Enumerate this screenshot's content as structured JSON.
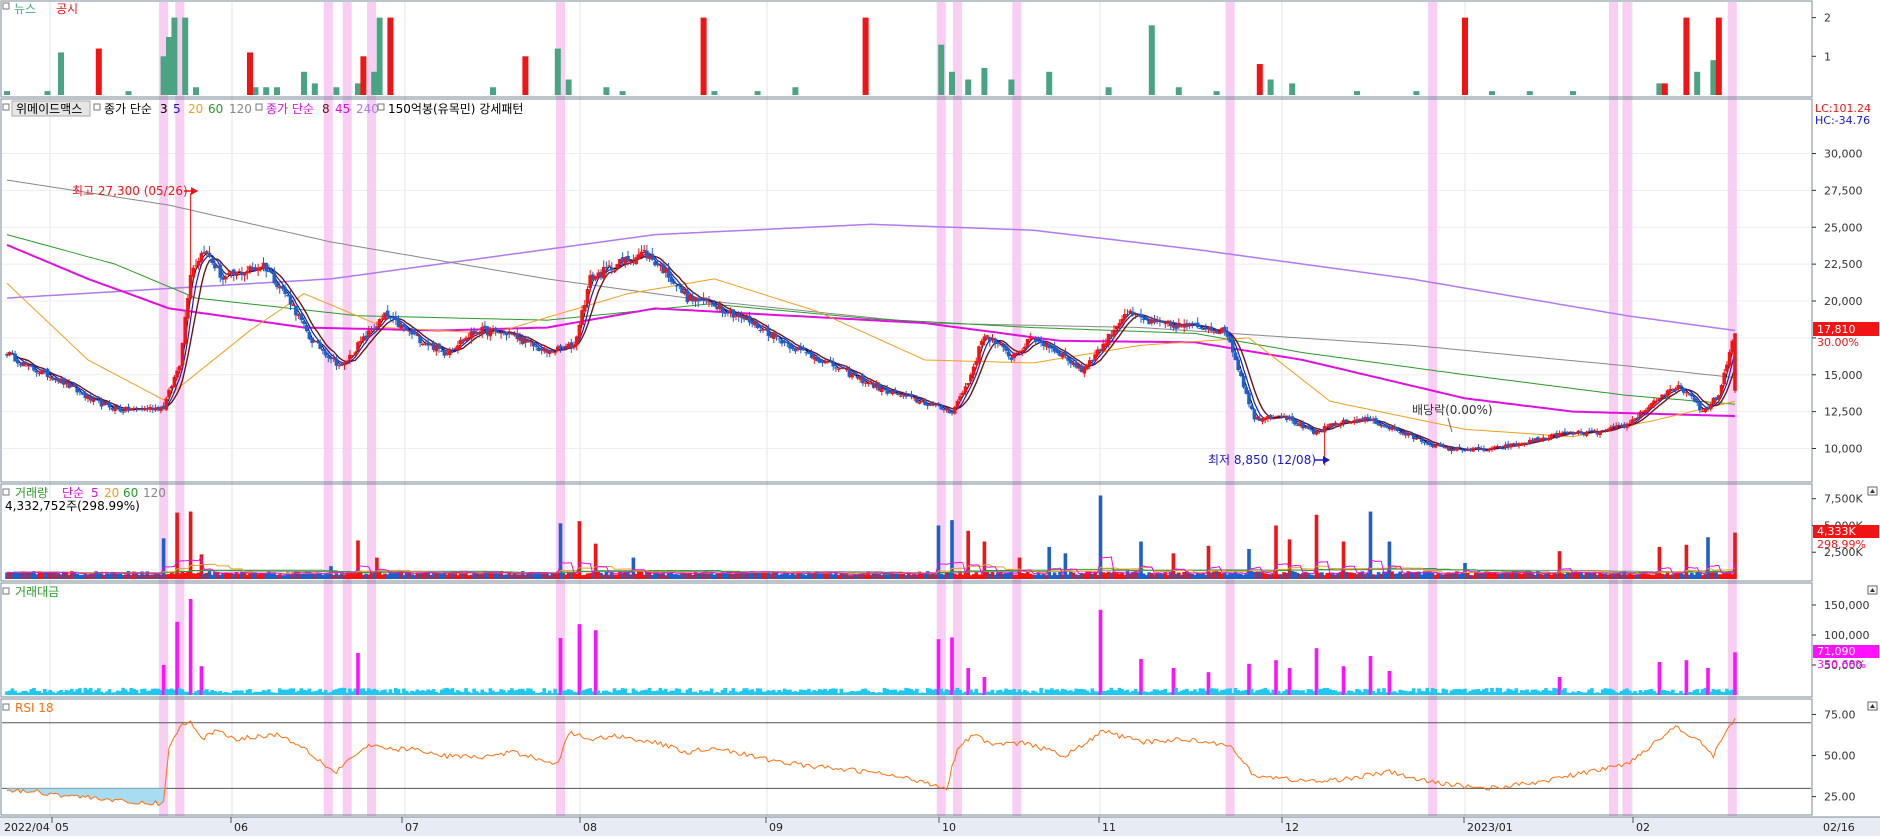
{
  "colors": {
    "up": "#f01414",
    "down": "#1e5fc8",
    "news": "#4aa382",
    "highlight": "#f7c6f1",
    "ma3": "#000000",
    "ma5": "#1818c8",
    "ma20": "#f0a020",
    "ma60": "#2a9a2a",
    "ma120": "#888888",
    "ma8": "#6a1414",
    "ma45": "#e010e0",
    "ma240": "#b07af0",
    "volMa5": "#e010e0",
    "volMa20": "#f0a020",
    "volMa60": "#2a9a2a",
    "volMa120": "#888888",
    "amtHigh": "#ff10ff",
    "amtLow": "#20c8f0",
    "rsi": "#ff7010",
    "rsiFill": "#a8dcf0"
  },
  "panels": {
    "news": {
      "label_news": "뉴스",
      "label_disclosure": "공시",
      "ticks": [
        "2",
        "1"
      ]
    },
    "price": {
      "stock_name": "위메이드맥스",
      "ma_group1": "종가 단순",
      "ma_group1_periods": [
        "3",
        "5",
        "20",
        "60",
        "120"
      ],
      "ma_group2": "종가 단순",
      "ma_group2_periods": [
        "8",
        "45",
        "240"
      ],
      "pattern": "150억봉(유목민) 강세패턴",
      "lc_label": "LC:101.24",
      "hc_label": "HC:-34.76",
      "ticks": [
        "30,000",
        "27,500",
        "25,000",
        "22,500",
        "20,000",
        "17,500",
        "15,000",
        "12,500",
        "10,000"
      ],
      "last_price": "17,810",
      "last_change": "30.00%",
      "high_annotation": "최고 27,300 (05/26)",
      "low_annotation": "최저 8,850 (12/08)",
      "dividend_annotation": "배당락(0.00%)"
    },
    "volume": {
      "title": "거래량",
      "ma_label": "단순",
      "ma_periods": [
        "5",
        "20",
        "60",
        "120"
      ],
      "info": "4,332,752주(298.99%)",
      "ticks": [
        "7,500K",
        "5,000K",
        "2,500K"
      ],
      "last_value": "4,333K",
      "last_pct": "298.99%"
    },
    "amount": {
      "title": "거래대금",
      "ticks": [
        "150,000",
        "100,000",
        "50,000"
      ],
      "last_value": "71,090",
      "last_pct": "350.68%"
    },
    "rsi": {
      "title": "RSI 18",
      "ticks": [
        "75.00",
        "50.00",
        "25.00"
      ]
    }
  },
  "x_axis": {
    "labels": [
      "2022/04",
      "05",
      "06",
      "07",
      "08",
      "09",
      "10",
      "11",
      "12",
      "2023/01",
      "02",
      "02/16"
    ]
  },
  "chart_data": {
    "type": "candlestick",
    "x_start": "2022/04",
    "x_end": "02/16",
    "price": {
      "ylim": [
        8000,
        32000
      ],
      "anchors": [
        [
          0,
          16500
        ],
        [
          8,
          15500
        ],
        [
          18,
          14800
        ],
        [
          32,
          13200
        ],
        [
          42,
          12600
        ],
        [
          58,
          12800
        ],
        [
          64,
          15800
        ],
        [
          68,
          22000
        ],
        [
          73,
          23500
        ],
        [
          80,
          21500
        ],
        [
          95,
          22500
        ],
        [
          105,
          20000
        ],
        [
          112,
          17500
        ],
        [
          124,
          15500
        ],
        [
          130,
          17000
        ],
        [
          140,
          19000
        ],
        [
          152,
          17500
        ],
        [
          162,
          16500
        ],
        [
          174,
          18000
        ],
        [
          186,
          17800
        ],
        [
          200,
          16500
        ],
        [
          210,
          17000
        ],
        [
          216,
          21500
        ],
        [
          226,
          22500
        ],
        [
          236,
          23300
        ],
        [
          244,
          22000
        ],
        [
          252,
          20200
        ],
        [
          262,
          19800
        ],
        [
          276,
          18500
        ],
        [
          292,
          16800
        ],
        [
          306,
          15600
        ],
        [
          324,
          14000
        ],
        [
          338,
          13200
        ],
        [
          350,
          12500
        ],
        [
          356,
          14500
        ],
        [
          362,
          17800
        ],
        [
          372,
          16200
        ],
        [
          380,
          17500
        ],
        [
          390,
          16500
        ],
        [
          398,
          15300
        ],
        [
          406,
          17000
        ],
        [
          414,
          19200
        ],
        [
          424,
          18500
        ],
        [
          436,
          18300
        ],
        [
          446,
          18200
        ],
        [
          452,
          17800
        ],
        [
          462,
          12000
        ],
        [
          472,
          12300
        ],
        [
          484,
          11000
        ],
        [
          492,
          11700
        ],
        [
          504,
          12000
        ],
        [
          520,
          10800
        ],
        [
          532,
          10000
        ],
        [
          548,
          9900
        ],
        [
          560,
          10300
        ],
        [
          576,
          11000
        ],
        [
          590,
          11100
        ],
        [
          600,
          11600
        ],
        [
          612,
          13500
        ],
        [
          620,
          14200
        ],
        [
          628,
          12500
        ],
        [
          634,
          13600
        ],
        [
          640,
          17810
        ]
      ],
      "high": {
        "index": 68,
        "value": 27300,
        "date": "05/26"
      },
      "low": {
        "index": 488,
        "value": 8850,
        "date": "12/08"
      },
      "last": 17810,
      "last_change_pct": 30.0
    },
    "moving_averages": {
      "ma240": [
        [
          0,
          20200
        ],
        [
          120,
          21500
        ],
        [
          240,
          24500
        ],
        [
          320,
          25200
        ],
        [
          380,
          24800
        ],
        [
          440,
          23500
        ],
        [
          520,
          21500
        ],
        [
          600,
          19000
        ],
        [
          640,
          18000
        ]
      ],
      "ma120": [
        [
          0,
          28200
        ],
        [
          60,
          26500
        ],
        [
          120,
          24000
        ],
        [
          200,
          21500
        ],
        [
          260,
          20000
        ],
        [
          340,
          18500
        ],
        [
          420,
          18200
        ],
        [
          520,
          17000
        ],
        [
          600,
          15600
        ],
        [
          640,
          14800
        ]
      ],
      "ma60": [
        [
          0,
          24500
        ],
        [
          40,
          22500
        ],
        [
          70,
          20200
        ],
        [
          130,
          19000
        ],
        [
          200,
          18700
        ],
        [
          260,
          19800
        ],
        [
          320,
          18800
        ],
        [
          380,
          18200
        ],
        [
          440,
          17800
        ],
        [
          480,
          16500
        ],
        [
          540,
          15000
        ],
        [
          600,
          13600
        ],
        [
          640,
          13000
        ]
      ],
      "ma45": [
        [
          0,
          23800
        ],
        [
          30,
          21500
        ],
        [
          60,
          19500
        ],
        [
          110,
          18200
        ],
        [
          160,
          18000
        ],
        [
          200,
          18200
        ],
        [
          240,
          19500
        ],
        [
          290,
          19000
        ],
        [
          340,
          18500
        ],
        [
          390,
          17300
        ],
        [
          440,
          17200
        ],
        [
          480,
          16000
        ],
        [
          540,
          13400
        ],
        [
          580,
          12500
        ],
        [
          640,
          12200
        ]
      ],
      "ma20": [
        [
          0,
          21200
        ],
        [
          30,
          16000
        ],
        [
          58,
          13300
        ],
        [
          90,
          18000
        ],
        [
          110,
          20500
        ],
        [
          140,
          18200
        ],
        [
          180,
          17800
        ],
        [
          230,
          20500
        ],
        [
          262,
          21500
        ],
        [
          300,
          19300
        ],
        [
          340,
          16000
        ],
        [
          380,
          15800
        ],
        [
          420,
          17000
        ],
        [
          460,
          17500
        ],
        [
          490,
          13200
        ],
        [
          540,
          11300
        ],
        [
          580,
          10800
        ],
        [
          610,
          11900
        ],
        [
          640,
          13200
        ]
      ]
    },
    "volume": {
      "ylim": [
        0,
        8500000
      ],
      "unit": "주",
      "last": 4332752,
      "last_pct": 298.99,
      "spikes": [
        [
          58,
          3800000
        ],
        [
          63,
          6200000
        ],
        [
          68,
          6300000
        ],
        [
          72,
          2300000
        ],
        [
          120,
          1200000
        ],
        [
          130,
          3600000
        ],
        [
          137,
          2000000
        ],
        [
          205,
          5200000
        ],
        [
          212,
          5400000
        ],
        [
          218,
          3300000
        ],
        [
          232,
          2000000
        ],
        [
          345,
          5000000
        ],
        [
          350,
          5500000
        ],
        [
          356,
          4500000
        ],
        [
          362,
          3500000
        ],
        [
          375,
          2000000
        ],
        [
          386,
          3000000
        ],
        [
          392,
          2400000
        ],
        [
          405,
          7800000
        ],
        [
          420,
          3500000
        ],
        [
          432,
          2400000
        ],
        [
          445,
          3100000
        ],
        [
          460,
          2800000
        ],
        [
          470,
          5000000
        ],
        [
          475,
          3700000
        ],
        [
          485,
          6000000
        ],
        [
          495,
          3500000
        ],
        [
          505,
          6300000
        ],
        [
          512,
          3500000
        ],
        [
          540,
          1500000
        ],
        [
          575,
          2600000
        ],
        [
          612,
          3000000
        ],
        [
          622,
          3200000
        ],
        [
          630,
          3900000
        ],
        [
          640,
          4332752
        ]
      ]
    },
    "amount": {
      "ylim": [
        0,
        175000
      ],
      "last": 71090,
      "last_pct": 350.68,
      "spikes": [
        [
          58,
          50000
        ],
        [
          63,
          122000
        ],
        [
          68,
          160000
        ],
        [
          72,
          48000
        ],
        [
          130,
          70000
        ],
        [
          205,
          95000
        ],
        [
          212,
          118000
        ],
        [
          218,
          108000
        ],
        [
          345,
          93000
        ],
        [
          350,
          96000
        ],
        [
          356,
          45000
        ],
        [
          362,
          30000
        ],
        [
          405,
          142000
        ],
        [
          420,
          60000
        ],
        [
          432,
          45000
        ],
        [
          445,
          38000
        ],
        [
          460,
          52000
        ],
        [
          470,
          58000
        ],
        [
          475,
          45000
        ],
        [
          485,
          78000
        ],
        [
          495,
          48000
        ],
        [
          505,
          65000
        ],
        [
          512,
          40000
        ],
        [
          575,
          30000
        ],
        [
          612,
          55000
        ],
        [
          622,
          58000
        ],
        [
          630,
          45000
        ],
        [
          640,
          71090
        ]
      ]
    },
    "rsi": {
      "ylim": [
        15,
        82
      ],
      "levels": [
        30,
        70
      ],
      "anchors": [
        [
          0,
          29
        ],
        [
          10,
          28
        ],
        [
          20,
          26
        ],
        [
          35,
          24
        ],
        [
          45,
          21
        ],
        [
          58,
          21
        ],
        [
          60,
          55
        ],
        [
          64,
          68
        ],
        [
          68,
          70
        ],
        [
          72,
          60
        ],
        [
          78,
          66
        ],
        [
          84,
          60
        ],
        [
          100,
          63
        ],
        [
          110,
          55
        ],
        [
          118,
          44
        ],
        [
          122,
          40
        ],
        [
          126,
          47
        ],
        [
          134,
          56
        ],
        [
          140,
          54
        ],
        [
          150,
          54
        ],
        [
          160,
          50
        ],
        [
          176,
          49
        ],
        [
          188,
          52
        ],
        [
          204,
          45
        ],
        [
          208,
          64
        ],
        [
          216,
          60
        ],
        [
          226,
          62
        ],
        [
          240,
          58
        ],
        [
          252,
          52
        ],
        [
          262,
          55
        ],
        [
          280,
          48
        ],
        [
          300,
          43
        ],
        [
          320,
          40
        ],
        [
          340,
          34
        ],
        [
          348,
          30
        ],
        [
          352,
          55
        ],
        [
          358,
          63
        ],
        [
          366,
          56
        ],
        [
          376,
          58
        ],
        [
          392,
          50
        ],
        [
          400,
          58
        ],
        [
          406,
          65
        ],
        [
          420,
          58
        ],
        [
          436,
          60
        ],
        [
          452,
          57
        ],
        [
          462,
          38
        ],
        [
          472,
          36
        ],
        [
          486,
          34
        ],
        [
          496,
          36
        ],
        [
          512,
          40
        ],
        [
          526,
          34
        ],
        [
          548,
          30
        ],
        [
          564,
          33
        ],
        [
          580,
          38
        ],
        [
          600,
          45
        ],
        [
          612,
          60
        ],
        [
          618,
          68
        ],
        [
          626,
          60
        ],
        [
          632,
          50
        ],
        [
          640,
          73
        ]
      ]
    },
    "news_bars": [
      [
        0,
        0.1
      ],
      [
        15,
        0.1
      ],
      [
        20,
        1.1
      ],
      [
        45,
        0.1
      ],
      [
        58,
        1.0
      ],
      [
        60,
        1.5
      ],
      [
        62,
        2.0
      ],
      [
        66,
        2.0
      ],
      [
        70,
        0.2
      ],
      [
        92,
        0.2
      ],
      [
        96,
        0.2
      ],
      [
        100,
        0.2
      ],
      [
        110,
        0.6
      ],
      [
        114,
        0.3
      ],
      [
        122,
        0.2
      ],
      [
        130,
        0.3
      ],
      [
        136,
        0.6
      ],
      [
        138,
        2.0
      ],
      [
        180,
        0.2
      ],
      [
        204,
        1.2
      ],
      [
        208,
        0.4
      ],
      [
        222,
        0.2
      ],
      [
        228,
        0.1
      ],
      [
        262,
        0.1
      ],
      [
        278,
        0.1
      ],
      [
        292,
        0.2
      ],
      [
        346,
        1.3
      ],
      [
        350,
        0.6
      ],
      [
        356,
        0.4
      ],
      [
        362,
        0.7
      ],
      [
        372,
        0.4
      ],
      [
        386,
        0.6
      ],
      [
        408,
        0.2
      ],
      [
        424,
        1.8
      ],
      [
        434,
        0.2
      ],
      [
        448,
        0.1
      ],
      [
        468,
        0.4
      ],
      [
        476,
        0.3
      ],
      [
        500,
        0.1
      ],
      [
        522,
        0.1
      ],
      [
        550,
        0.1
      ],
      [
        564,
        0.1
      ],
      [
        580,
        0.1
      ],
      [
        612,
        0.3
      ],
      [
        626,
        0.6
      ],
      [
        632,
        0.9
      ]
    ],
    "disclosure_bars": [
      [
        34,
        1.2
      ],
      [
        90,
        1.1
      ],
      [
        132,
        1.0
      ],
      [
        142,
        2.0
      ],
      [
        192,
        1.0
      ],
      [
        258,
        2.0
      ],
      [
        318,
        2.0
      ],
      [
        464,
        0.8
      ],
      [
        540,
        2.0
      ],
      [
        614,
        0.3
      ],
      [
        622,
        2.0
      ],
      [
        634,
        2.0
      ]
    ],
    "highlight_dates": [
      58,
      64,
      119,
      126,
      135,
      205,
      346,
      352,
      374,
      453,
      528,
      595,
      600,
      639
    ]
  }
}
